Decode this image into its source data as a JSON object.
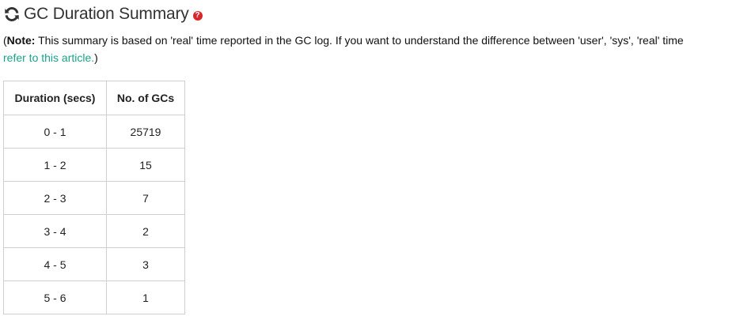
{
  "header": {
    "title": "GC Duration Summary",
    "help_glyph": "?"
  },
  "note": {
    "open_paren": "(",
    "bold_label": "Note:",
    "text": " This summary is based on 'real' time reported in the GC log. If you want to understand the difference between 'user', 'sys', 'real' time ",
    "link_text": "refer to this article.",
    "close_paren": ")"
  },
  "table": {
    "headers": [
      "Duration (secs)",
      "No. of GCs"
    ],
    "rows": [
      [
        "0 - 1",
        "25719"
      ],
      [
        "1 - 2",
        "15"
      ],
      [
        "2 - 3",
        "7"
      ],
      [
        "3 - 4",
        "2"
      ],
      [
        "4 - 5",
        "3"
      ],
      [
        "5 - 6",
        "1"
      ]
    ]
  },
  "colors": {
    "link": "#1aa38a",
    "help_badge": "#d9262b",
    "border": "#cfcfcf"
  }
}
